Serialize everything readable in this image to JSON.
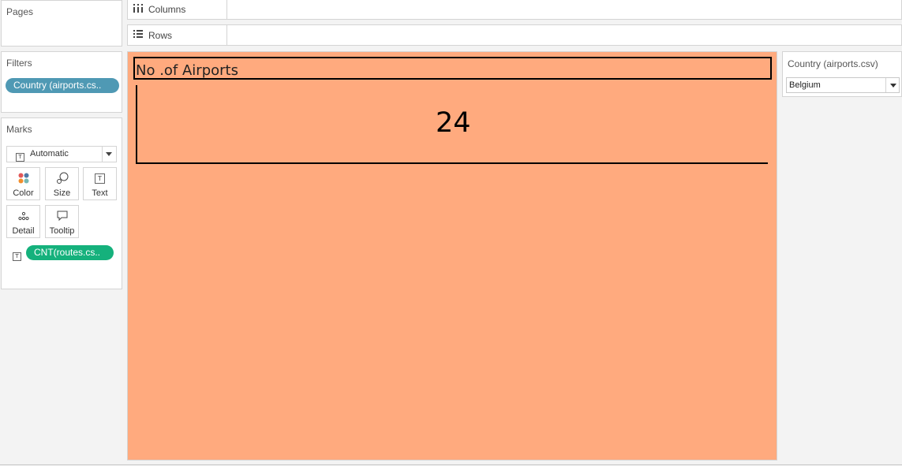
{
  "pages": {
    "title": "Pages"
  },
  "shelves": {
    "columns": {
      "label": "Columns",
      "icon": "columns-icon"
    },
    "rows": {
      "label": "Rows",
      "icon": "rows-icon"
    }
  },
  "filters": {
    "title": "Filters",
    "pills": [
      {
        "label": "Country (airports.cs..",
        "color": "#4f99b4"
      }
    ]
  },
  "marks": {
    "title": "Marks",
    "mark_type": "Automatic",
    "buttons": {
      "color": "Color",
      "size": "Size",
      "text": "Text",
      "detail": "Detail",
      "tooltip": "Tooltip"
    },
    "pills": [
      {
        "label": "CNT(routes.cs..",
        "color": "#15b17c"
      }
    ]
  },
  "viz": {
    "title": "No .of Airports",
    "value": "24",
    "background": "#ffaa7e"
  },
  "quick_filter": {
    "title": "Country (airports.csv)",
    "selected": "Belgium"
  }
}
